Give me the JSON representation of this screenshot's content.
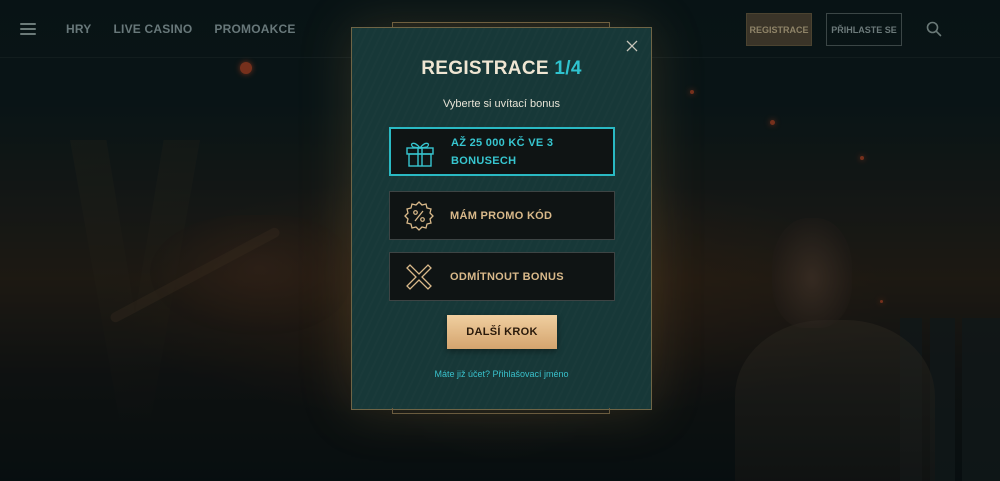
{
  "header": {
    "nav": [
      "HRY",
      "LIVE CASINO",
      "PROMOAKCE"
    ],
    "register_label": "REGISTRACE",
    "login_label": "PŘIHLASTE SE"
  },
  "modal": {
    "title": "REGISTRACE",
    "step": "1/4",
    "subtitle": "Vyberte si uvítací bonus",
    "options": [
      {
        "label": "AŽ 25 000 KČ VE 3 BONUSECH",
        "icon": "gift-icon",
        "selected": true
      },
      {
        "label": "MÁM PROMO KÓD",
        "icon": "percent-badge-icon",
        "selected": false
      },
      {
        "label": "ODMÍTNOUT BONUS",
        "icon": "cross-icon",
        "selected": false
      }
    ],
    "next_label": "DALŠÍ KROK",
    "login_link": "Máte již účet? Přihlašovací jméno"
  },
  "colors": {
    "accent_teal": "#2ab9c3",
    "gold": "#d9b98a",
    "modal_bg": "#173838",
    "button_gold": "#e3bb87"
  }
}
